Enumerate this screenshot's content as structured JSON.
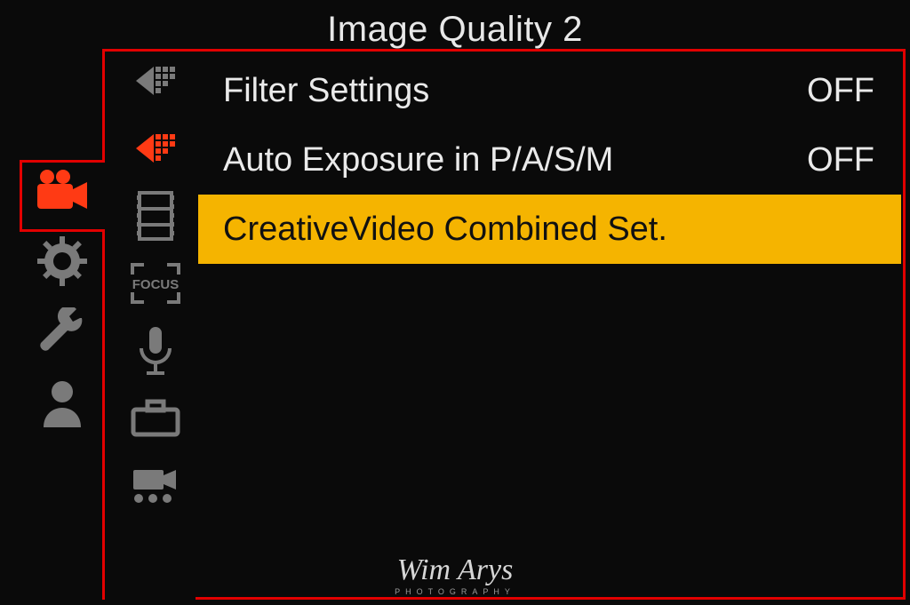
{
  "header": {
    "title": "Image Quality 2"
  },
  "rows": [
    {
      "label": "Filter Settings",
      "value": "OFF",
      "selected": false
    },
    {
      "label": "Auto Exposure in P/A/S/M",
      "value": "OFF",
      "selected": false
    },
    {
      "label": "CreativeVideo Combined Set.",
      "value": "",
      "selected": true
    }
  ],
  "primary_tabs": [
    {
      "name": "video",
      "active": true
    },
    {
      "name": "gear",
      "active": false
    },
    {
      "name": "wrench",
      "active": false
    },
    {
      "name": "person",
      "active": false
    }
  ],
  "secondary_tabs": [
    {
      "name": "image-quality-1",
      "active": false
    },
    {
      "name": "image-quality-2",
      "active": true
    },
    {
      "name": "filmstrip",
      "active": false
    },
    {
      "name": "focus-bracket",
      "active": false
    },
    {
      "name": "microphone",
      "active": false
    },
    {
      "name": "camera-body",
      "active": false
    },
    {
      "name": "video-settings",
      "active": false
    }
  ],
  "colors": {
    "accent_red": "#e20000",
    "accent_amber": "#f5b400",
    "icon_inactive": "#7a7a7a",
    "icon_active": "#ff3a14"
  },
  "watermark": {
    "signature": "Wim Arys",
    "subtitle": "PHOTOGRAPHY"
  }
}
